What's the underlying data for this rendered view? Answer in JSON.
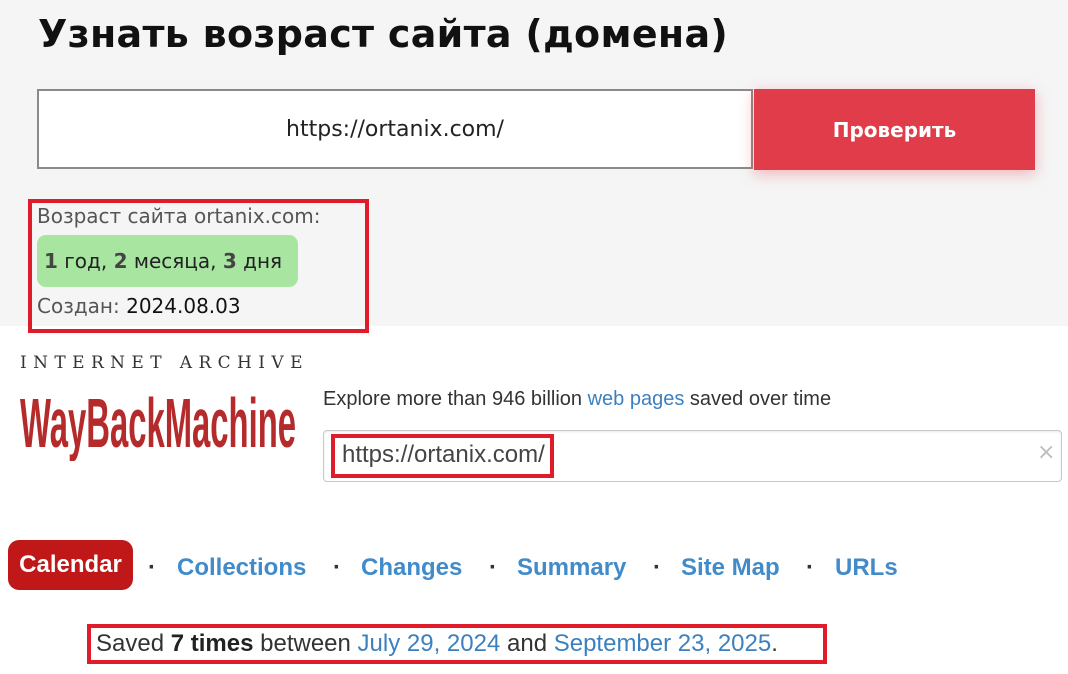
{
  "checker": {
    "title": "Узнать возраст сайта (домена)",
    "url_value": "https://ortanix.com/",
    "check_button": "Проверить",
    "age_label": "Возраст сайта ortanix.com:",
    "age": {
      "years_num": "1",
      "years_unit": "год,",
      "months_num": "2",
      "months_unit": "месяца,",
      "days_num": "3",
      "days_unit": "дня"
    },
    "created_label": "Создан:",
    "created_value": "2024.08.03"
  },
  "wayback": {
    "logo_top": "INTERNET ARCHIVE",
    "logo_text": "WayBackMachine",
    "explore_prefix": "Explore more than 946 billion",
    "explore_link": "web pages",
    "explore_suffix": "saved over time",
    "search_value": "https://ortanix.com/",
    "clear_icon": "×",
    "tabs": [
      "Calendar",
      "Collections",
      "Changes",
      "Summary",
      "Site Map",
      "URLs"
    ],
    "separator": "·",
    "saved": {
      "prefix": "Saved",
      "count": "7 times",
      "between": "between",
      "first_date": "July 29, 2024",
      "and": "and",
      "last_date": "September 23, 2025",
      "end": "."
    }
  },
  "colors": {
    "accent_red": "#e03c4a",
    "highlight_red": "#e01b2a",
    "age_green": "#a7e5a1",
    "link_blue": "#428bca",
    "calendar_red": "#c01818"
  }
}
